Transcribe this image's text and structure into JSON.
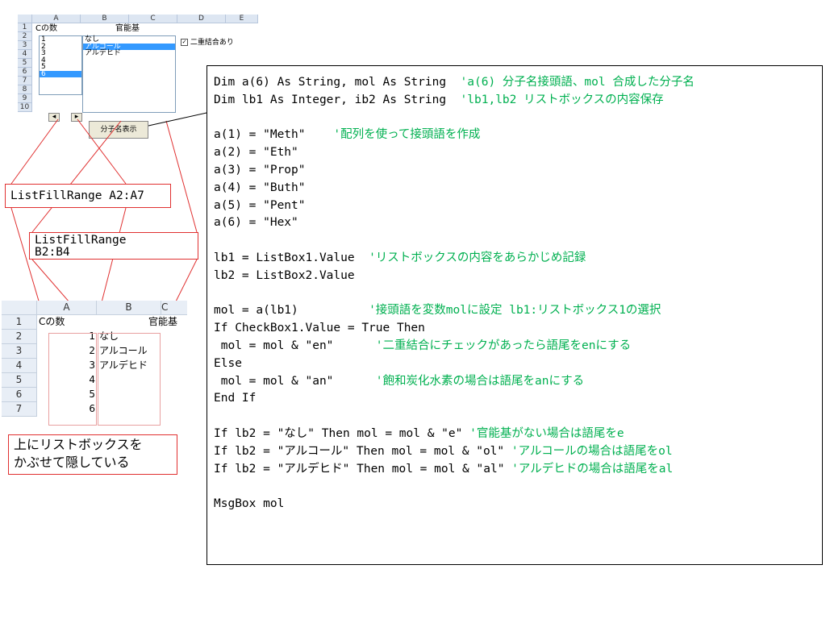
{
  "excel_top": {
    "col_headers": [
      "A",
      "B",
      "C",
      "D",
      "E"
    ],
    "row_headers": [
      "1",
      "2",
      "3",
      "4",
      "5",
      "6",
      "7",
      "8",
      "9",
      "10"
    ],
    "a1": "Cの数",
    "b1": "官能基",
    "listbox1_items": [
      "1",
      "2",
      "3",
      "4",
      "5",
      "6"
    ],
    "listbox1_selected_index": 5,
    "listbox2_items": [
      "なし",
      "アルコール",
      "アルデヒド"
    ],
    "listbox2_selected_index": 1,
    "checkbox_label": "二重結合あり",
    "checkbox_checked": true,
    "button_label": "分子名表示"
  },
  "callouts": {
    "lfr_a": "ListFillRange A2:A7",
    "lfr_b_line1": "ListFillRange",
    "lfr_b_line2": "B2:B4"
  },
  "sheet_bottom": {
    "col_headers": [
      "A",
      "B",
      "C"
    ],
    "row_headers": [
      "1",
      "2",
      "3",
      "4",
      "5",
      "6",
      "7"
    ],
    "a1": "Cの数",
    "b1": "官能基",
    "a_values": [
      "1",
      "2",
      "3",
      "4",
      "5",
      "6"
    ],
    "b_values": [
      "なし",
      "アルコール",
      "アルデヒド",
      "",
      "",
      ""
    ]
  },
  "note": {
    "line1": "上にリストボックスを",
    "line2": "かぶせて隠している"
  },
  "code": [
    {
      "code": "Dim a(6) As String, mol As String  ",
      "comment": "'a(6) 分子名接頭語、mol 合成した分子名"
    },
    {
      "code": "Dim lb1 As Integer, ib2 As String  ",
      "comment": "'lb1,lb2 リストボックスの内容保存"
    },
    {
      "code": "",
      "comment": ""
    },
    {
      "code": "a(1) = \"Meth\"    ",
      "comment": "'配列を使って接頭語を作成"
    },
    {
      "code": "a(2) = \"Eth\"",
      "comment": ""
    },
    {
      "code": "a(3) = \"Prop\"",
      "comment": ""
    },
    {
      "code": "a(4) = \"Buth\"",
      "comment": ""
    },
    {
      "code": "a(5) = \"Pent\"",
      "comment": ""
    },
    {
      "code": "a(6) = \"Hex\"",
      "comment": ""
    },
    {
      "code": "",
      "comment": ""
    },
    {
      "code": "lb1 = ListBox1.Value  ",
      "comment": "'リストボックスの内容をあらかじめ記録"
    },
    {
      "code": "lb2 = ListBox2.Value",
      "comment": ""
    },
    {
      "code": "",
      "comment": ""
    },
    {
      "code": "mol = a(lb1)          ",
      "comment": "'接頭語を変数molに設定 lb1:リストボックス1の選択"
    },
    {
      "code": "If CheckBox1.Value = True Then",
      "comment": ""
    },
    {
      "code": " mol = mol & \"en\"      ",
      "comment": "'二重結合にチェックがあったら語尾をenにする"
    },
    {
      "code": "Else",
      "comment": ""
    },
    {
      "code": " mol = mol & \"an\"      ",
      "comment": "'飽和炭化水素の場合は語尾をanにする"
    },
    {
      "code": "End If",
      "comment": ""
    },
    {
      "code": "",
      "comment": ""
    },
    {
      "code": "If lb2 = \"なし\" Then mol = mol & \"e\" ",
      "comment": "'官能基がない場合は語尾をe"
    },
    {
      "code": "If lb2 = \"アルコール\" Then mol = mol & \"ol\" ",
      "comment": "'アルコールの場合は語尾をol"
    },
    {
      "code": "If lb2 = \"アルデヒド\" Then mol = mol & \"al\" ",
      "comment": "'アルデヒドの場合は語尾をal"
    },
    {
      "code": "",
      "comment": ""
    },
    {
      "code": "MsgBox mol",
      "comment": ""
    }
  ]
}
